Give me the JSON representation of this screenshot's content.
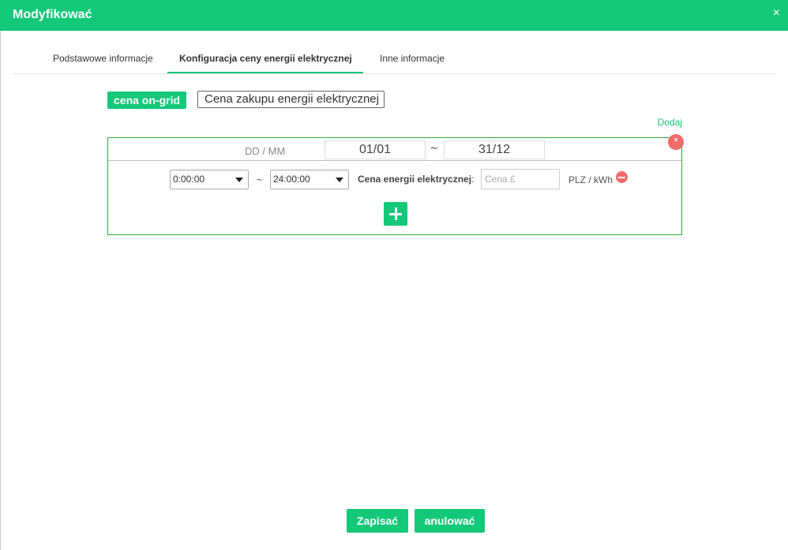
{
  "dialog": {
    "title": "Modyfikować",
    "close_icon": "×"
  },
  "tabs": [
    {
      "label": "Podstawowe informacje",
      "active": false
    },
    {
      "label": "Konfiguracja ceny energii elektrycznej",
      "active": true
    },
    {
      "label": "Inne informacje",
      "active": false
    }
  ],
  "price_type": {
    "active_label": "cena on-grid",
    "inactive_label": "Cena zakupu energii elektrycznej"
  },
  "add_link": "Dodaj",
  "period": {
    "date_format_label": "DD / MM",
    "start_date": "01/01",
    "separator": "~",
    "end_date": "31/12",
    "remove_icon": "×",
    "rows": [
      {
        "start_time": "0:00:00",
        "separator": "~",
        "end_time": "24:00:00",
        "price_label": "Cena energii elektrycznej",
        "price_colon": ":",
        "price_value": "",
        "price_placeholder": "Cena £",
        "unit": "PLZ / kWh"
      }
    ]
  },
  "buttons": {
    "save": "Zapisać",
    "cancel": "anulować"
  },
  "colors": {
    "accent": "#13c879",
    "danger": "#f26b6b",
    "period_border": "#2fa83a"
  }
}
